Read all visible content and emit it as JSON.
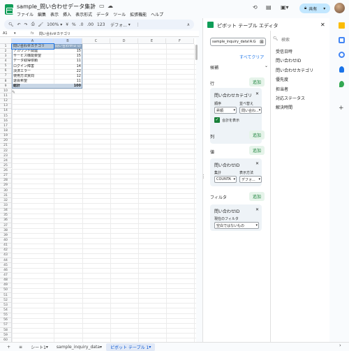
{
  "header": {
    "title": "sample_問い合わせデータ集計",
    "menu": [
      "ファイル",
      "編集",
      "表示",
      "挿入",
      "表示形式",
      "データ",
      "ツール",
      "拡張機能",
      "ヘルプ"
    ],
    "share_label": "共有"
  },
  "toolbar": {
    "zoom": "100%",
    "currency": "¥",
    "percent": "%",
    "dec_less": ".0",
    "dec_more": ".00",
    "num_fmt": "123",
    "font": "デフォ..."
  },
  "formula": {
    "cell_ref": "A1",
    "fx": "fx",
    "content": "問い合わせカテゴリ"
  },
  "columns": [
    "A",
    "B",
    "C",
    "D",
    "E",
    "F"
  ],
  "rows": [
    [
      "問い合わせカテゴリ",
      "問い合わせID の"
    ],
    [
      "アカウント関連",
      "15"
    ],
    [
      "サービス機能要望",
      "15"
    ],
    [
      "データ取得依頼",
      "11"
    ],
    [
      "ログイン障害",
      "14"
    ],
    [
      "決済エラー",
      "22"
    ],
    [
      "使用方法質問",
      "12"
    ],
    [
      "退会希望",
      "11"
    ],
    [
      "総計",
      "100"
    ]
  ],
  "row_count": 60,
  "tabs": {
    "add": "+",
    "menu": "≡",
    "sheets": [
      {
        "label": "シート1"
      },
      {
        "label": "sample_inquiry_data"
      },
      {
        "label": "ピボット テーブル 1"
      }
    ]
  },
  "editor": {
    "title": "ピボット テーブル エディタ",
    "range": "sample_inquiry_data!A:G",
    "clear": "すべてクリア",
    "suggest": "候補",
    "rows_label": "行",
    "add": "追加",
    "row_field": "問い合わせカテゴリ",
    "order_label": "順序",
    "order_val": "昇順",
    "sort_label": "並べ替え",
    "sort_val": "問い合わ...",
    "show_totals": "合計を表示",
    "cols_label": "列",
    "values_label": "値",
    "value_field": "問い合わせID",
    "summarize_label": "集計",
    "summarize_val": "COUNTA",
    "show_as_label": "表示方法",
    "show_as_val": "デフォ...",
    "filters_label": "フィルタ",
    "filter_field": "問い合わせID",
    "filter_status_label": "現在のフィルタ",
    "filter_status_val": "空白ではないもの",
    "search_placeholder": "検索",
    "fields": [
      "受信日時",
      "問い合わせID",
      "問い合わせカテゴリ",
      "優先度",
      "担当者",
      "対応ステータス",
      "解決時間"
    ]
  }
}
